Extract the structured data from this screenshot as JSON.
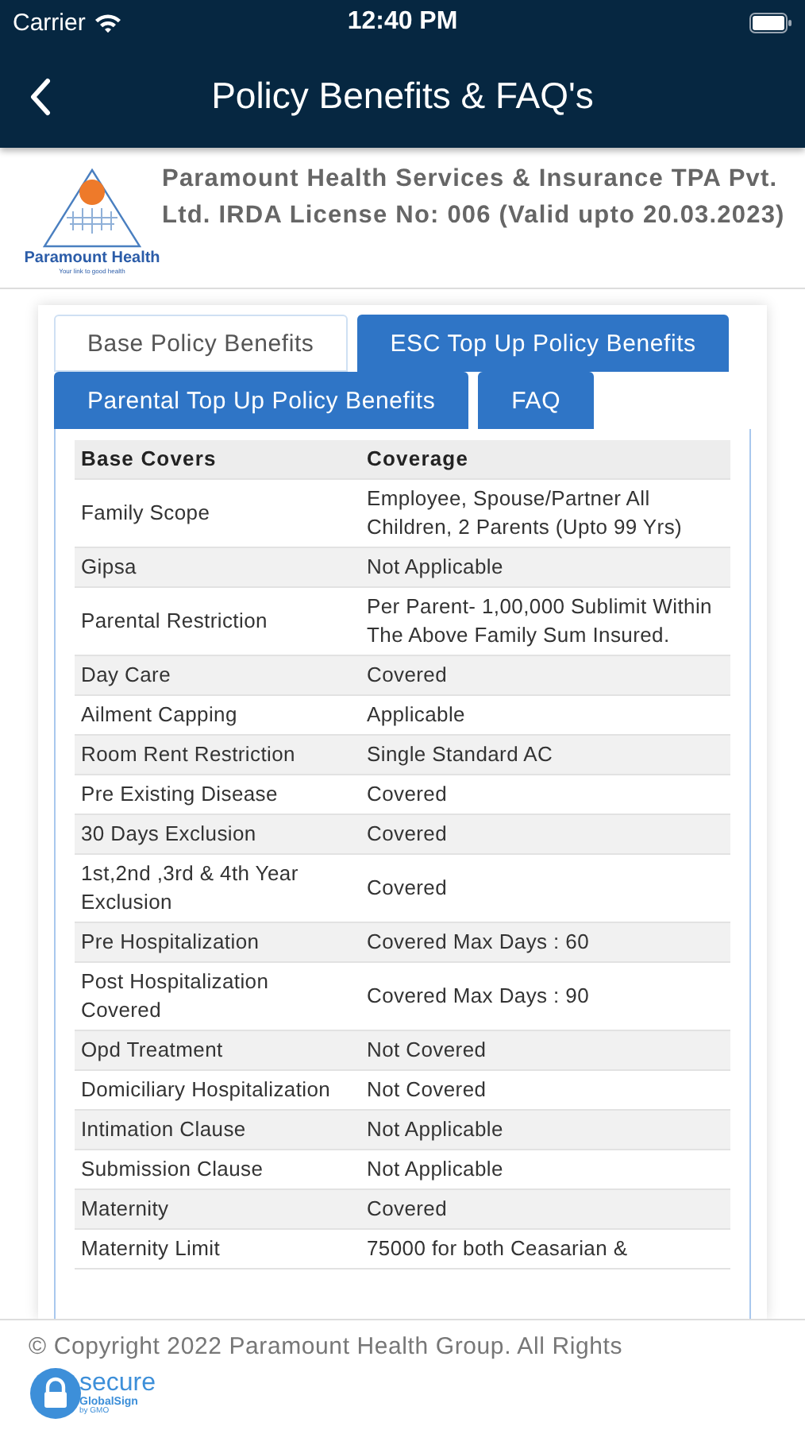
{
  "status_bar": {
    "carrier": "Carrier",
    "time": "12:40 PM"
  },
  "nav_bar": {
    "title": "Policy Benefits & FAQ's"
  },
  "company": {
    "logo_name": "Paramount Health",
    "logo_tagline": "Your link to good health",
    "text": "Paramount Health Services & Insurance TPA Pvt. Ltd. IRDA License No: 006 (Valid upto 20.03.2023)"
  },
  "tabs": [
    {
      "label": "Base Policy Benefits",
      "selected": true
    },
    {
      "label": "ESC Top Up Policy Benefits",
      "selected": false
    },
    {
      "label": "Parental Top Up Policy Benefits",
      "selected": false
    },
    {
      "label": "FAQ",
      "selected": false
    }
  ],
  "table": {
    "columns": [
      "Base Covers",
      "Coverage"
    ],
    "rows": [
      [
        "Family Scope",
        "Employee, Spouse/Partner All Children, 2 Parents (Upto 99 Yrs)"
      ],
      [
        "Gipsa",
        "Not Applicable"
      ],
      [
        "Parental Restriction",
        "Per Parent- 1,00,000 Sublimit Within The Above Family Sum Insured."
      ],
      [
        "Day Care",
        "Covered"
      ],
      [
        "Ailment Capping",
        "Applicable"
      ],
      [
        "Room Rent Restriction",
        "Single Standard AC"
      ],
      [
        "Pre Existing Disease",
        "Covered"
      ],
      [
        "30 Days Exclusion",
        "Covered"
      ],
      [
        "1st,2nd ,3rd & 4th Year Exclusion",
        "Covered"
      ],
      [
        "Pre Hospitalization",
        "Covered Max Days : 60"
      ],
      [
        "Post Hospitalization Covered",
        "Covered Max Days : 90"
      ],
      [
        "Opd Treatment",
        "Not Covered"
      ],
      [
        "Domiciliary Hospitalization",
        "Not Covered"
      ],
      [
        "Intimation Clause",
        "Not Applicable"
      ],
      [
        "Submission Clause",
        "Not Applicable"
      ],
      [
        "Maternity",
        "Covered"
      ],
      [
        "Maternity Limit",
        "75000 for both Ceasarian &"
      ]
    ]
  },
  "footer": {
    "copyright": "© Copyright 2022 Paramount Health Group. All Rights",
    "badge": {
      "title": "secure",
      "brand": "GlobalSign",
      "by": "by GMO"
    }
  }
}
